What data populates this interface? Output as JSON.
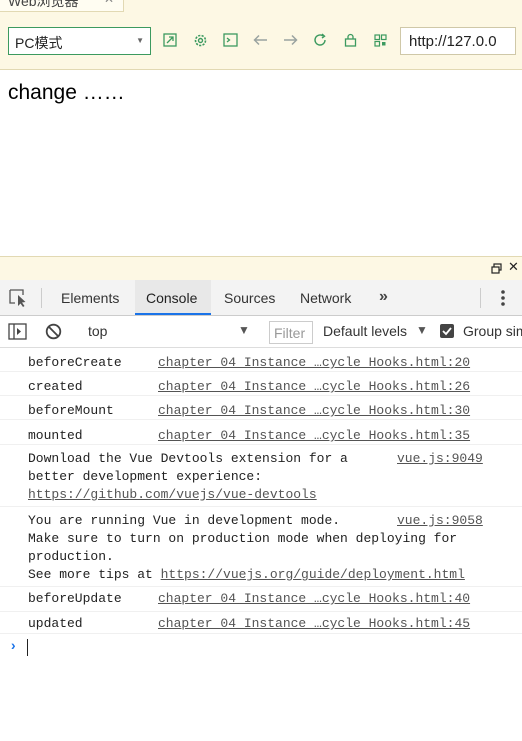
{
  "browser": {
    "tab_title": "Web浏览器",
    "tab_close": "✕",
    "mode_select": "PC模式",
    "url": "http://127.0.0"
  },
  "page": {
    "text": "change ……"
  },
  "devtools": {
    "close": "✕",
    "tabs": [
      "Elements",
      "Console",
      "Sources",
      "Network"
    ],
    "active_tab": "Console",
    "more": "»",
    "console_toolbar": {
      "context": "top",
      "filter_placeholder": "Filter",
      "levels": "Default levels",
      "group_label": "Group similar",
      "group_checked": true
    },
    "messages": [
      {
        "text": "beforeCreate",
        "source": "chapter 04 Instance …cycle Hooks.html:20"
      },
      {
        "text": "created",
        "source": "chapter 04 Instance …cycle Hooks.html:26"
      },
      {
        "text": "beforeMount",
        "source": "chapter 04 Instance …cycle Hooks.html:30"
      },
      {
        "text": "mounted",
        "source": "chapter 04 Instance …cycle Hooks.html:35"
      },
      {
        "text": "Download the Vue Devtools extension for a\nbetter development experience:",
        "link": "https://github.com/vuejs/vue-devtools",
        "source": "vue.js:9049"
      },
      {
        "text": "You are running Vue in development mode.\nMake sure to turn on production mode when deploying for\nproduction.\nSee more tips at ",
        "link": "https://vuejs.org/guide/deployment.html",
        "source": "vue.js:9058"
      },
      {
        "text": "beforeUpdate",
        "source": "chapter 04 Instance …cycle Hooks.html:40"
      },
      {
        "text": "updated",
        "source": "chapter 04 Instance …cycle Hooks.html:45"
      }
    ],
    "prompt": "›"
  },
  "colors": {
    "browser_bg": "#fdf8e4",
    "accent_green": "#3c9a5f",
    "active_tab_underline": "#1a73e8"
  },
  "icons": [
    "open-new-icon",
    "settings-gear-icon",
    "terminal-icon",
    "back-arrow-icon",
    "forward-arrow-icon",
    "refresh-icon",
    "lock-icon",
    "qr-icon"
  ]
}
